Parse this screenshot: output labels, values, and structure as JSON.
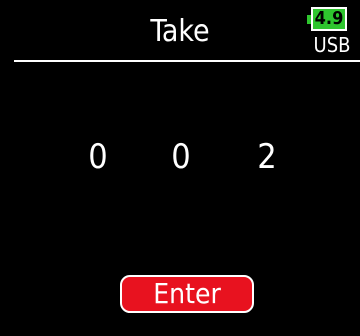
{
  "header": {
    "title": "Take",
    "battery_level": "4.9",
    "power_source": "USB",
    "battery_color": "#2ec52e"
  },
  "take_number": {
    "digits": [
      "0",
      "0",
      "2"
    ]
  },
  "actions": {
    "enter_label": "Enter",
    "enter_color": "#e8121f"
  }
}
